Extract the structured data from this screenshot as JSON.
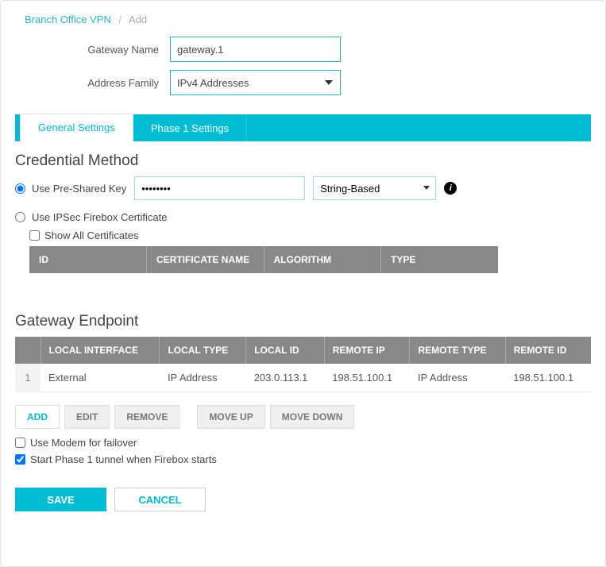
{
  "breadcrumb": {
    "parent": "Branch Office VPN",
    "current": "Add"
  },
  "form": {
    "gateway_name_label": "Gateway Name",
    "gateway_name_value": "gateway.1",
    "address_family_label": "Address Family",
    "address_family_value": "IPv4 Addresses"
  },
  "tabs": {
    "general": "General Settings",
    "phase1": "Phase 1 Settings"
  },
  "credential": {
    "heading": "Credential Method",
    "use_psk_label": "Use Pre-Shared Key",
    "psk_value": "••••••••",
    "psk_type": "String-Based",
    "use_cert_label": "Use IPSec Firebox Certificate",
    "show_all_label": "Show All Certificates"
  },
  "cert_table": {
    "headers": {
      "id": "ID",
      "name": "CERTIFICATE NAME",
      "algo": "ALGORITHM",
      "type": "TYPE"
    }
  },
  "endpoint": {
    "heading": "Gateway Endpoint",
    "headers": {
      "num": "",
      "local_if": "LOCAL INTERFACE",
      "local_type": "LOCAL TYPE",
      "local_id": "LOCAL ID",
      "remote_ip": "REMOTE IP",
      "remote_type": "REMOTE TYPE",
      "remote_id": "REMOTE ID"
    },
    "rows": [
      {
        "num": "1",
        "local_if": "External",
        "local_type": "IP Address",
        "local_id": "203.0.113.1",
        "remote_ip": "198.51.100.1",
        "remote_type": "IP Address",
        "remote_id": "198.51.100.1"
      }
    ]
  },
  "buttons": {
    "add": "ADD",
    "edit": "EDIT",
    "remove": "REMOVE",
    "moveup": "MOVE UP",
    "movedown": "MOVE DOWN",
    "save": "SAVE",
    "cancel": "CANCEL"
  },
  "options": {
    "modem_failover": "Use Modem for failover",
    "start_phase1": "Start Phase 1 tunnel when Firebox starts"
  }
}
